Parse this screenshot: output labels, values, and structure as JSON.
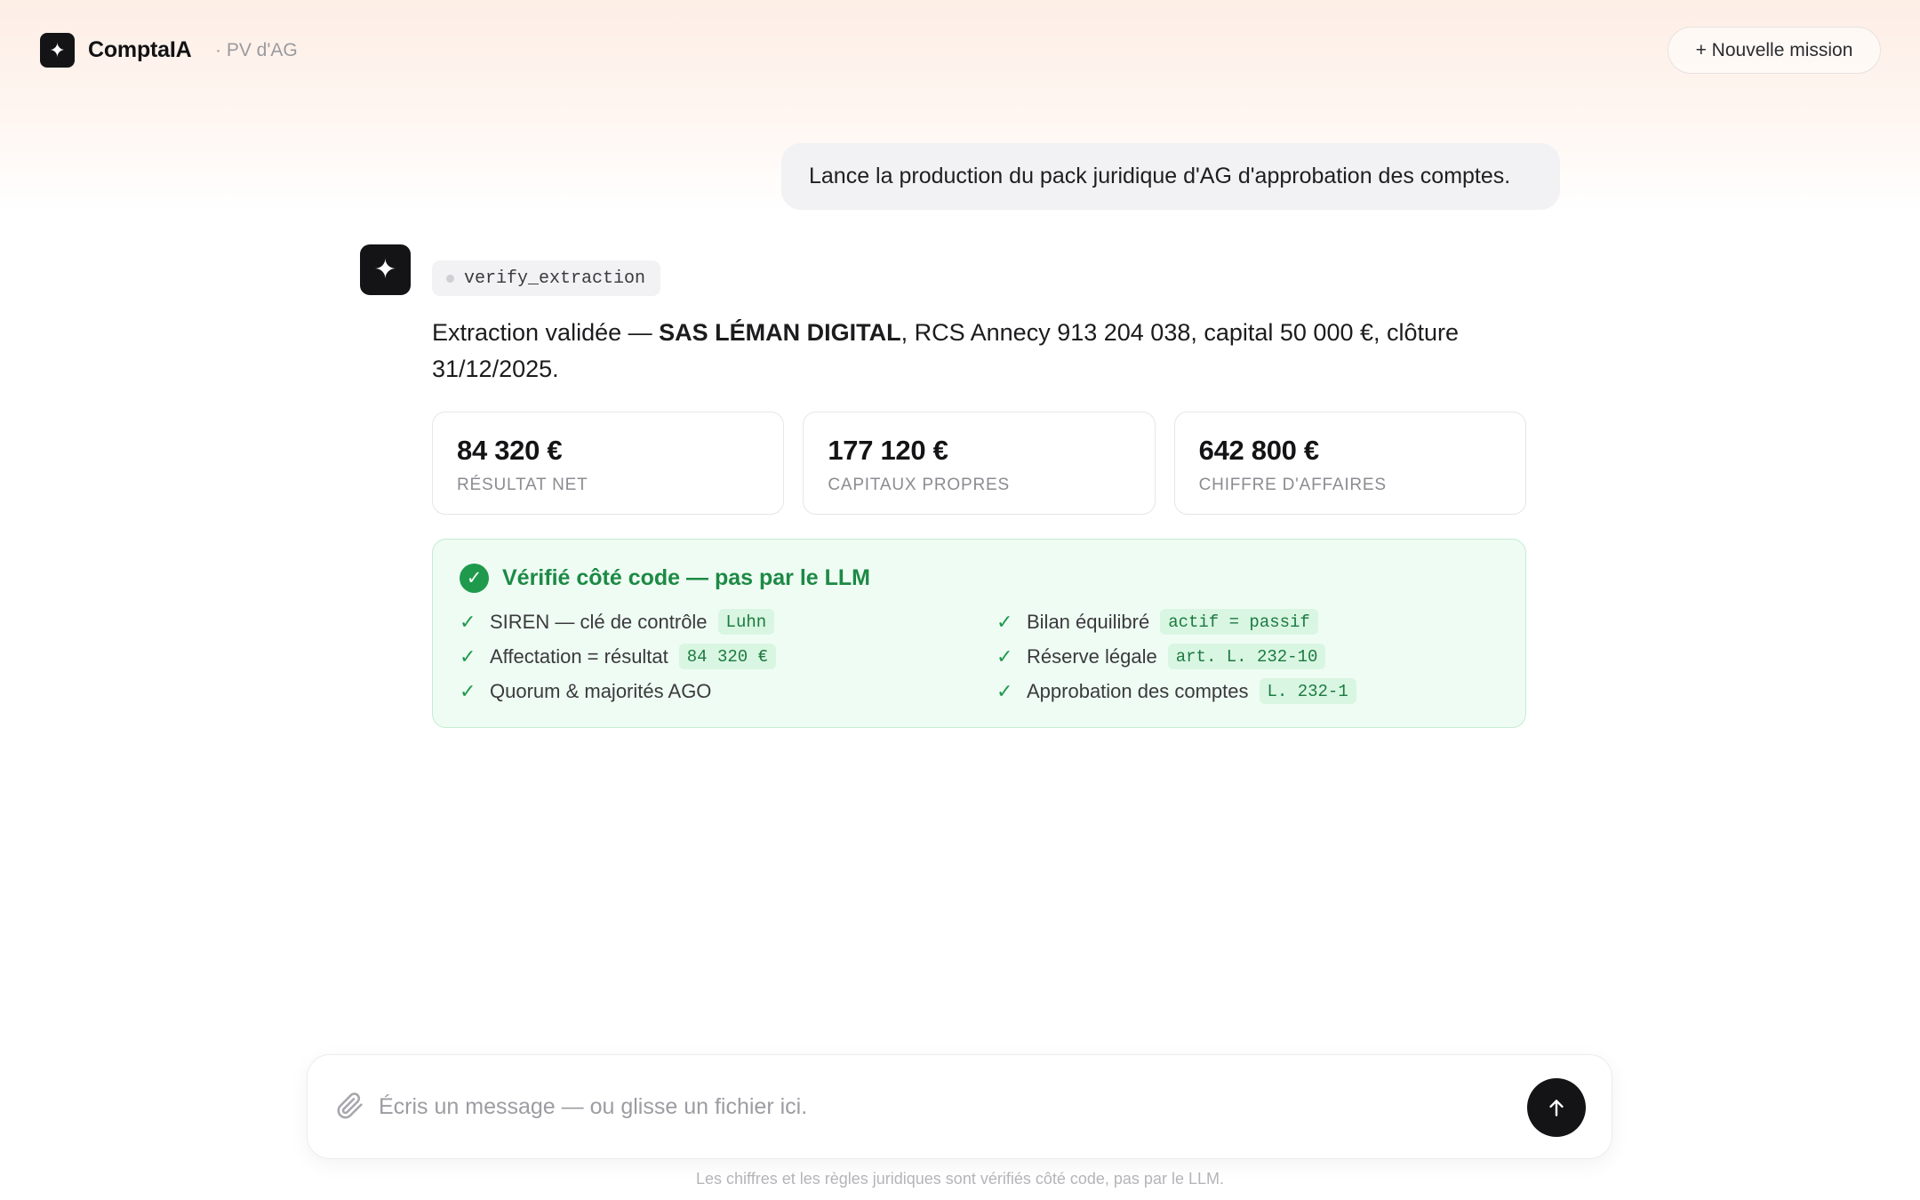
{
  "header": {
    "brand_icon": "✦",
    "brand_name": "ComptaIA",
    "brand_sub": "· PV d'AG",
    "new_mission_label": "+ Nouvelle mission"
  },
  "conversation": {
    "user_message": "Lance la production du pack juridique d'AG d'approbation des comptes.",
    "assistant": {
      "avatar_icon": "✦",
      "tool_name": "verify_extraction",
      "text_prefix": "Extraction validée — ",
      "company_name": "SAS LÉMAN DIGITAL",
      "text_suffix": ", RCS Annecy 913 204 038, capital 50 000 €, clôture 31/12/2025.",
      "metrics": [
        {
          "value": "84 320 €",
          "label": "Résultat net"
        },
        {
          "value": "177 120 €",
          "label": "Capitaux propres"
        },
        {
          "value": "642 800 €",
          "label": "Chiffre d'affaires"
        }
      ],
      "verification": {
        "title": "Vérifié côté code — pas par le LLM",
        "check_icon": "✓",
        "left_checks": [
          {
            "label": "SIREN — clé de contrôle",
            "tag": "Luhn"
          },
          {
            "label": "Affectation = résultat",
            "tag": "84 320 €"
          },
          {
            "label": "Quorum & majorités AGO",
            "tag": ""
          }
        ],
        "right_checks": [
          {
            "label": "Bilan équilibré",
            "tag": "actif = passif"
          },
          {
            "label": "Réserve légale",
            "tag": "art. L. 232-10"
          },
          {
            "label": "Approbation des comptes",
            "tag": "L. 232-1"
          }
        ]
      }
    }
  },
  "composer": {
    "placeholder": "Écris un message — ou glisse un fichier ici.",
    "value": "",
    "attach_icon": "paperclip-icon",
    "send_icon": "arrow-up-icon"
  },
  "footer": {
    "note": "Les chiffres et les règles juridiques sont vérifiés côté code, pas par le LLM."
  },
  "colors": {
    "accent_dark": "#141416",
    "success": "#1f9a4d",
    "success_bg": "#effcf3"
  }
}
